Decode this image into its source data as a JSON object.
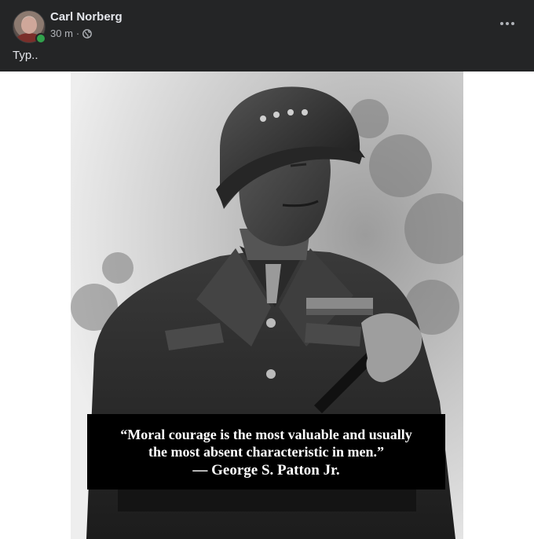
{
  "post": {
    "author": "Carl Norberg",
    "time": "30 m",
    "separator": "·",
    "privacy_icon": "globe-icon",
    "text": "Typ..",
    "more_icon": "more-options-icon"
  },
  "image": {
    "quote_line1": "“Moral courage is the most valuable and usually",
    "quote_line2": "the most absent characteristic in men.”",
    "quote_author": "— George S. Patton Jr."
  },
  "colors": {
    "header_bg": "#242526",
    "name_text": "#e4e6eb",
    "meta_text": "#b0b3b8",
    "online": "#31a24c"
  }
}
